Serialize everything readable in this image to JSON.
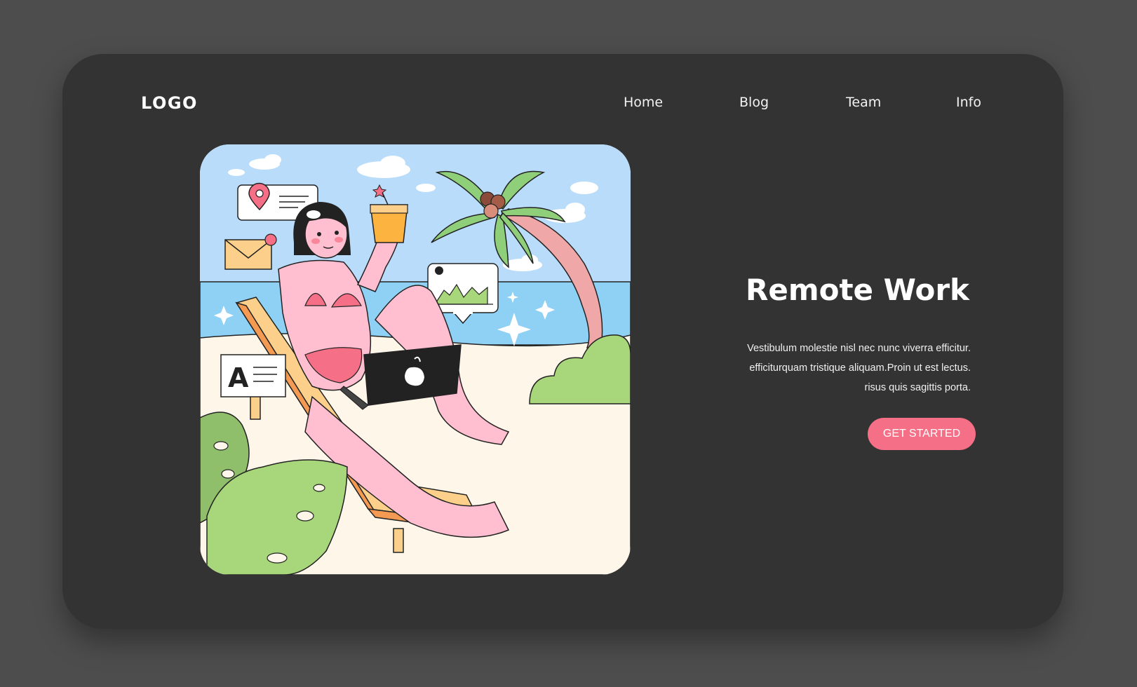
{
  "header": {
    "logo_text": "LOGO",
    "nav": [
      {
        "label": "Home"
      },
      {
        "label": "Blog"
      },
      {
        "label": "Team"
      },
      {
        "label": "Info"
      }
    ]
  },
  "hero": {
    "title": "Remote Work",
    "body_lines": [
      "Vestibulum molestie nisl nec nunc viverra efficitur.",
      "efficiturquam tristique aliquam.Proin ut est lectus.",
      "risus quis sagittis porta."
    ],
    "cta_label": "GET STARTED"
  },
  "illustration": {
    "doc_letter": "A"
  },
  "colors": {
    "page_bg": "#4d4d4d",
    "card_bg": "#333333",
    "accent": "#f56f86",
    "sky": "#b9dcfb",
    "sea": "#8fd0f5",
    "sand": "#fff6ea"
  }
}
